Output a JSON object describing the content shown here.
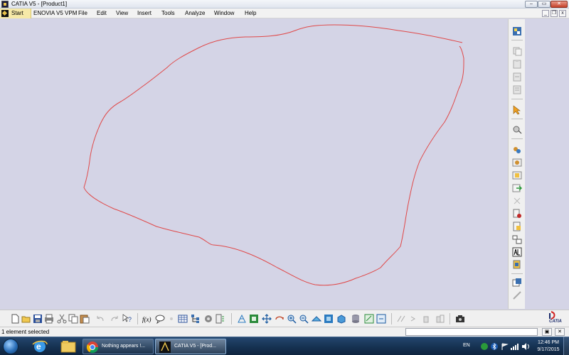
{
  "window": {
    "title": "CATIA V5 - [Product1]",
    "controls": {
      "minimize": "–",
      "maximize": "▭",
      "close": "✕"
    }
  },
  "menu": {
    "items": [
      "Start",
      "ENOVIA V5 VPM",
      "File",
      "Edit",
      "View",
      "Insert",
      "Tools",
      "Analyze",
      "Window",
      "Help"
    ],
    "mdi_controls": {
      "minimize": "_",
      "restore": "❐",
      "close": "x"
    }
  },
  "canvas": {
    "background": "#d4d4e6",
    "sketch_color": "#e04848"
  },
  "right_toolbar": {
    "icons": [
      "product-icon",
      "copy-icon",
      "paste-icon",
      "paste-special-icon",
      "clipboard-icon",
      "select-icon",
      "snap-icon",
      "component-icon",
      "product-insert-icon",
      "part-insert-icon",
      "existing-component-icon",
      "replace-component-icon",
      "graph-tree-icon",
      "reorder-icon",
      "numbering-icon",
      "selective-load-icon",
      "manage-representations-icon",
      "multi-instantiation-icon",
      "fast-multi-instantiation-icon"
    ]
  },
  "bottom_toolbar": {
    "icons": [
      "new-icon",
      "open-icon",
      "save-icon",
      "print-icon",
      "cut-icon",
      "copy-icon",
      "paste-icon",
      "undo-icon",
      "redo-icon",
      "whats-this-icon",
      "formula-icon",
      "catalog-icon",
      "knowledge-icon",
      "table-icon",
      "tree-icon",
      "publish-icon",
      "wizard-icon",
      "fly-mode-icon",
      "fit-all-icon",
      "pan-icon",
      "rotate-icon",
      "zoom-in-icon",
      "zoom-out-icon",
      "normal-view-icon",
      "iso-view-icon",
      "views-icon",
      "render-style-icon",
      "hide-show-icon",
      "swap-space-icon",
      "measure-between-icon",
      "measure-item-icon",
      "measure-inertia-icon",
      "snapshot-icon"
    ]
  },
  "status": {
    "message": "1 element selected",
    "power_input_value": ""
  },
  "catia_logo": {
    "text": "CATIA"
  },
  "taskbar": {
    "tasks": [
      {
        "label": "Nothing appears !..."
      },
      {
        "label": "CATIA V5 - [Prod..."
      }
    ],
    "tray": {
      "language": "EN",
      "time": "12:46 PM",
      "date": "9/17/2015"
    }
  }
}
